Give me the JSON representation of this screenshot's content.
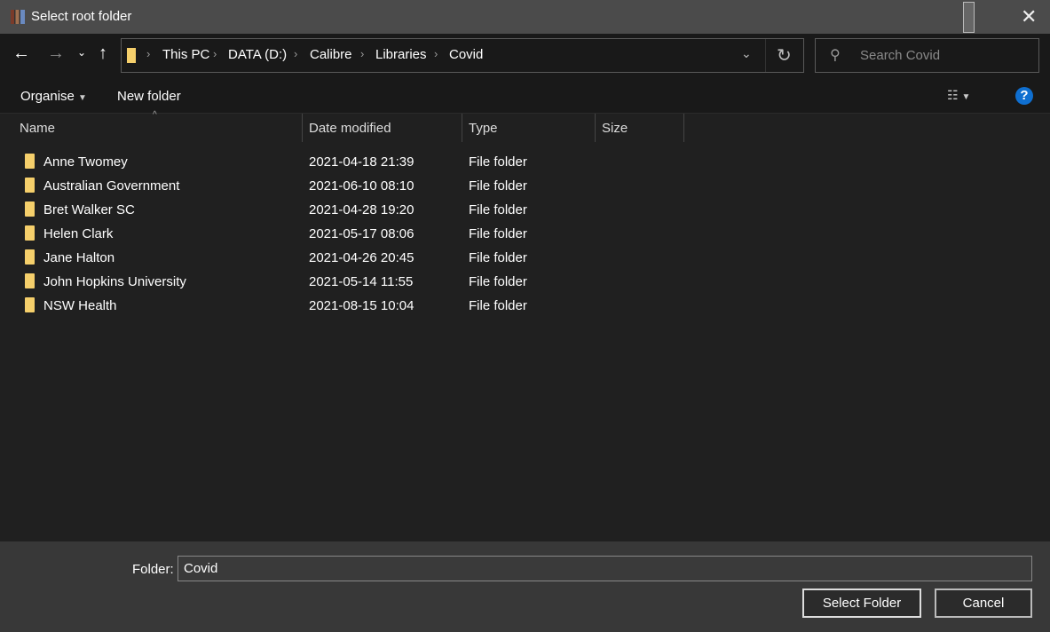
{
  "window": {
    "title": "Select root folder"
  },
  "address": {
    "crumbs": [
      "This PC",
      "DATA (D:)",
      "Calibre",
      "Libraries",
      "Covid"
    ]
  },
  "search": {
    "placeholder": "Search Covid"
  },
  "toolbar": {
    "organise": "Organise",
    "new_folder": "New folder"
  },
  "columns": [
    "Name",
    "Date modified",
    "Type",
    "Size"
  ],
  "files": [
    {
      "name": "Anne Twomey",
      "date": "2021-04-18 21:39",
      "type": "File folder"
    },
    {
      "name": "Australian Government",
      "date": "2021-06-10 08:10",
      "type": "File folder"
    },
    {
      "name": "Bret Walker SC",
      "date": "2021-04-28 19:20",
      "type": "File folder"
    },
    {
      "name": "Helen Clark",
      "date": "2021-05-17 08:06",
      "type": "File folder"
    },
    {
      "name": "Jane Halton",
      "date": "2021-04-26 20:45",
      "type": "File folder"
    },
    {
      "name": "John Hopkins University",
      "date": "2021-05-14 11:55",
      "type": "File folder"
    },
    {
      "name": "NSW Health",
      "date": "2021-08-15 10:04",
      "type": "File folder"
    }
  ],
  "footer": {
    "folder_label": "Folder:",
    "folder_value": "Covid",
    "select_label": "Select Folder",
    "cancel_label": "Cancel"
  }
}
